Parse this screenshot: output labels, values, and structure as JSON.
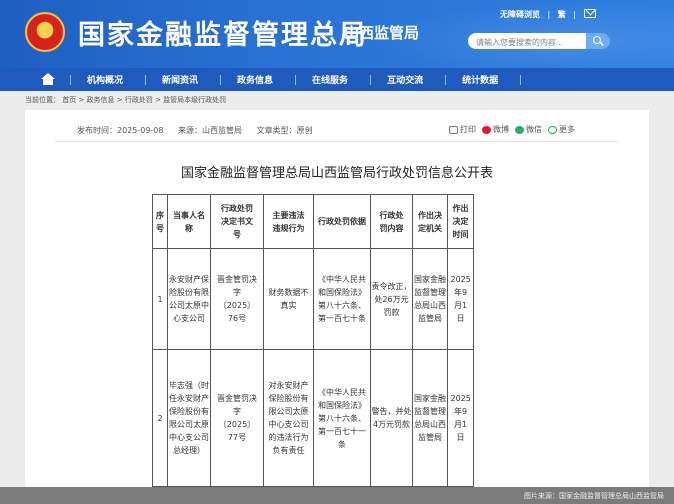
{
  "header": {
    "title": "国家金融监督管理总局",
    "subtitle": "山西监管局",
    "links": [
      "无障碍浏览",
      "繁"
    ],
    "search_placeholder": "请输入您要搜索的内容..."
  },
  "nav": {
    "items": [
      "机构概况",
      "新闻资讯",
      "政务信息",
      "在线服务",
      "互动交流",
      "统计数据"
    ]
  },
  "breadcrumb": "当前位置： 首页 > 政务信息 > 行政处罚 > 监管局本级行政处罚",
  "meta": {
    "publish_time": "发布时间：2025-09-08",
    "source": "来源：山西监管局",
    "doc_type": "文章类型：原创"
  },
  "share": {
    "print": "打印",
    "weibo": "微博",
    "wechat": "微信",
    "more": "更多"
  },
  "doc_title": "国家金融监督管理总局山西监管局行政处罚信息公开表",
  "table": {
    "headers": [
      "序号",
      "当事人名称",
      "行政处罚决定书文号",
      "主要违法违规行为",
      "行政处罚依据",
      "行政处罚内容",
      "作出决定机关",
      "作出决定时间"
    ],
    "rows": [
      {
        "no": "1",
        "party": "永安财产保险股份有限公司太原中心支公司",
        "doc_no": "晋金管罚决字〔2025〕76号",
        "violation": "财务数据不真实",
        "basis": "《中华人民共和国保险法》第八十六条、第一百七十条",
        "content": "责令改正，处26万元罚款",
        "authority": "国家金融监督管理总局山西监管局",
        "date": "2025年9月1日"
      },
      {
        "no": "2",
        "party": "毕志强（时任永安财产保险股份有限公司太原中心支公司总经理）",
        "doc_no": "晋金管罚决字〔2025〕77号",
        "violation": "对永安财产保险股份有限公司太原中心支公司的违法行为负有责任",
        "basis": "《中华人民共和国保险法》第八十六条、第一百七十一条",
        "content": "警告，并处4万元罚款",
        "authority": "国家金融监督管理总局山西监管局",
        "date": "2025年9月1日"
      }
    ]
  },
  "footer": "图片来源：国家金融监督管理总局山西监管局"
}
